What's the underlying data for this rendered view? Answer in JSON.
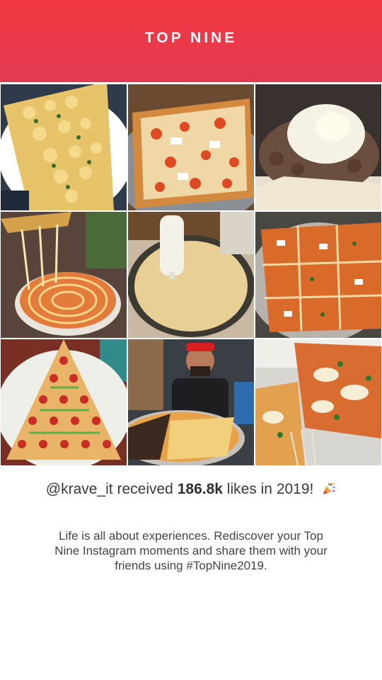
{
  "header": {
    "title": "TOP NINE"
  },
  "summary": {
    "username": "@krave_it",
    "received_text": "received",
    "likes_count": "186.8k",
    "likes_suffix": "likes in 2019!",
    "emoji_icon": "party-popper-icon"
  },
  "description": "Life is all about experiences. Rediscover your Top Nine Instagram moments and share them with your friends using #TopNine2019.",
  "grid": {
    "photos": [
      {
        "subject": "mac and cheese pizza slice"
      },
      {
        "subject": "square pizza with melty cheese"
      },
      {
        "subject": "cheesesteak with white cheese"
      },
      {
        "subject": "cheese pull spiral pizza"
      },
      {
        "subject": "pizza dough with sauce bottle"
      },
      {
        "subject": "square sicilian pizza"
      },
      {
        "subject": "christmas tree pepperoni pizza"
      },
      {
        "subject": "man holding giant pizza"
      },
      {
        "subject": "vodka sauce pizza slice"
      }
    ]
  },
  "colors": {
    "header_top": "#f2383f",
    "header_bottom": "#e33a55",
    "text": "#3a3a3a"
  }
}
